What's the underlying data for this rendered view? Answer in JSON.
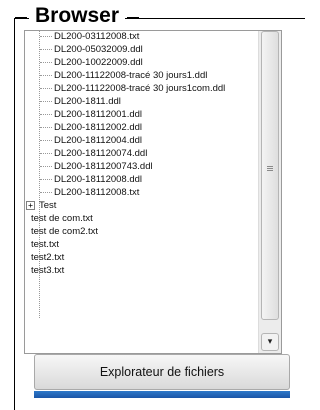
{
  "browser": {
    "title": "Browser"
  },
  "tree": {
    "items": [
      {
        "label": "DL200-03112008.txt"
      },
      {
        "label": "DL200-05032009.ddl"
      },
      {
        "label": "DL200-10022009.ddl"
      },
      {
        "label": "DL200-11122008-tracé 30 jours1.ddl"
      },
      {
        "label": "DL200-11122008-tracé 30 jours1com.ddl"
      },
      {
        "label": "DL200-1811.ddl"
      },
      {
        "label": "DL200-18112001.ddl"
      },
      {
        "label": "DL200-18112002.ddl"
      },
      {
        "label": "DL200-18112004.ddl"
      },
      {
        "label": "DL200-181120074.ddl"
      },
      {
        "label": "DL200-1811200743.ddl"
      },
      {
        "label": "DL200-18112008.ddl"
      },
      {
        "label": "DL200-18112008.txt"
      }
    ],
    "folder": {
      "label": "Test",
      "expander": "+"
    },
    "root_items": [
      {
        "label": "test de com.txt"
      },
      {
        "label": "test de com2.txt"
      },
      {
        "label": "test.txt"
      },
      {
        "label": "test2.txt"
      },
      {
        "label": "test3.txt"
      }
    ]
  },
  "scrollbar": {
    "down_arrow": "▾"
  },
  "actions": {
    "explorer_label": "Explorateur de fichiers"
  }
}
